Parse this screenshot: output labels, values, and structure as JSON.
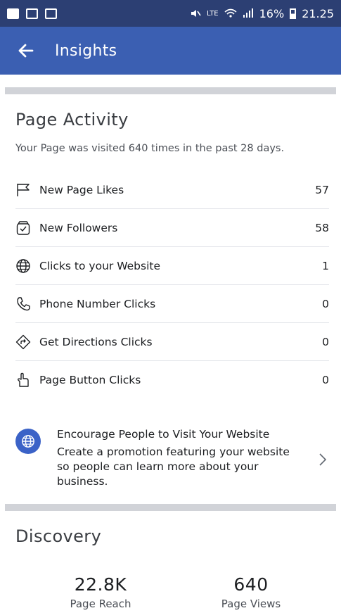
{
  "status_bar": {
    "left_icons": [
      "facebook-icon",
      "gallery-icon",
      "app-icon"
    ],
    "network": "LTE",
    "battery": "16%",
    "time": "21.25"
  },
  "app_bar": {
    "title": "Insights"
  },
  "page_activity": {
    "title": "Page Activity",
    "subtitle": "Your Page was visited 640 times in the past 28 days.",
    "rows": [
      {
        "label": "New Page Likes",
        "value": "57",
        "icon": "flag-icon"
      },
      {
        "label": "New Followers",
        "value": "58",
        "icon": "follow-icon"
      },
      {
        "label": "Clicks to your Website",
        "value": "1",
        "icon": "globe-icon"
      },
      {
        "label": "Phone Number Clicks",
        "value": "0",
        "icon": "phone-icon"
      },
      {
        "label": "Get Directions Clicks",
        "value": "0",
        "icon": "directions-icon"
      },
      {
        "label": "Page Button Clicks",
        "value": "0",
        "icon": "pointer-icon"
      }
    ]
  },
  "promo": {
    "title": "Encourage People to Visit Your Website",
    "description": "Create a promotion featuring your website so people can learn more about your business.",
    "icon": "globe-icon"
  },
  "discovery": {
    "title": "Discovery",
    "stats": [
      {
        "value": "22.8K",
        "label": "Page Reach"
      },
      {
        "value": "640",
        "label": "Page Views"
      }
    ]
  },
  "colors": {
    "status_bar": "#2c3f73",
    "app_bar": "#3b5fb2",
    "accent": "#3b62c7",
    "divider": "#d1d3d8"
  }
}
